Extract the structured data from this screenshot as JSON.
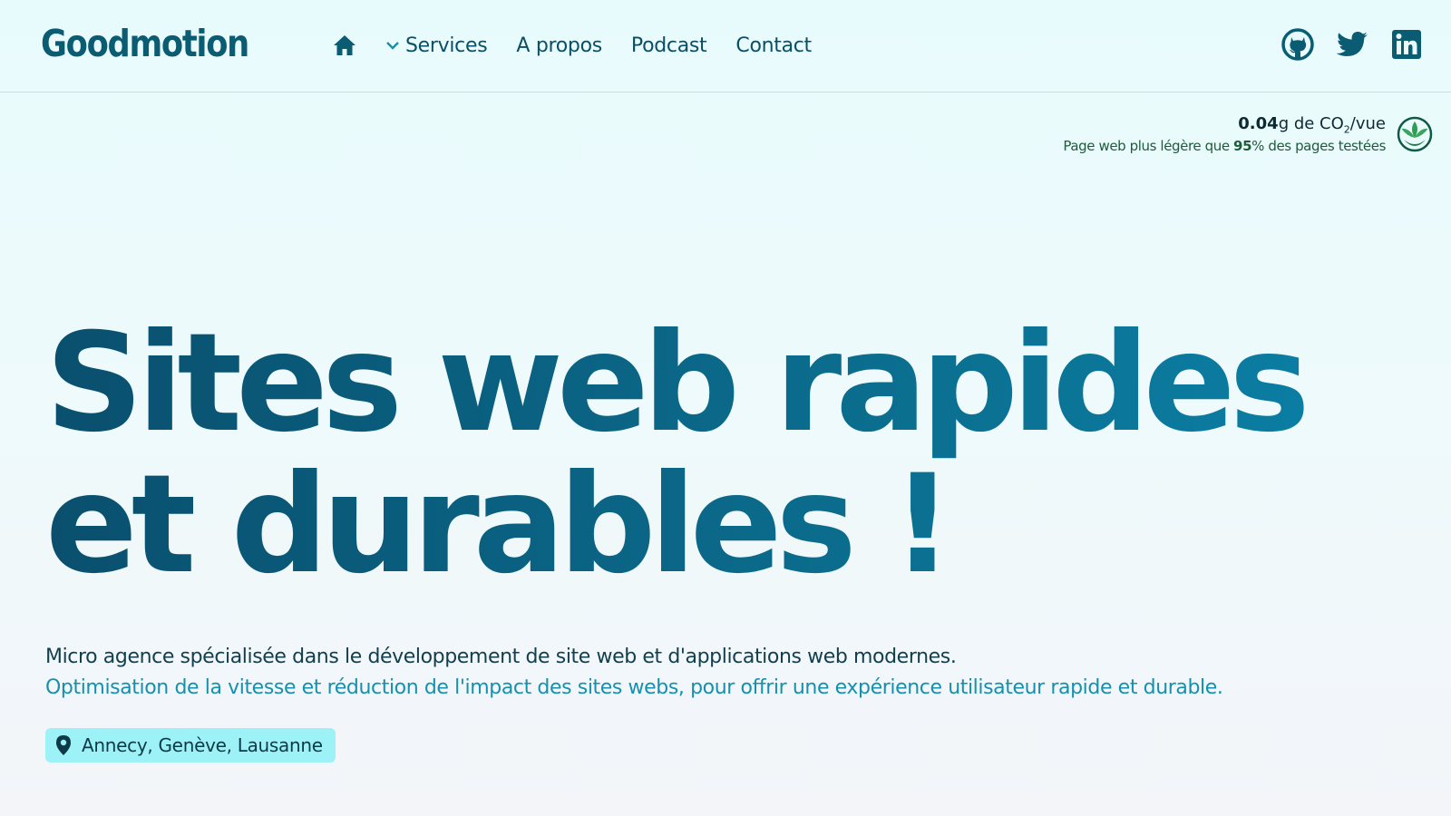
{
  "header": {
    "logo": "Goodmotion",
    "nav": {
      "home_icon": "home-icon",
      "items": [
        {
          "label": "Services",
          "has_dropdown": true
        },
        {
          "label": "A propos"
        },
        {
          "label": "Podcast"
        },
        {
          "label": "Contact"
        }
      ]
    },
    "socials": [
      "github-icon",
      "twitter-icon",
      "linkedin-icon"
    ]
  },
  "eco_badge": {
    "co2_value": "0.04",
    "co2_unit_prefix": "g de CO",
    "co2_sub": "2",
    "co2_suffix": "/vue",
    "line2_prefix": "Page web plus légère que ",
    "percent": "95",
    "line2_suffix": "% des pages testées",
    "icon": "leaf-icon"
  },
  "hero": {
    "title_line1": "Sites web rapides",
    "title_line2": "et durables !",
    "description_line1": "Micro agence spécialisée dans le développement de site web et d'applications web modernes.",
    "description_line2": "Optimisation de la vitesse et réduction de l'impact des sites webs, pour offrir une expérience utilisateur rapide et durable.",
    "location": "Annecy, Genève, Lausanne",
    "location_icon": "map-pin-icon"
  },
  "colors": {
    "brand": "#0a5c73",
    "accent": "#1590ad",
    "location_bg": "#9cf2f6",
    "eco_green": "#1e5b3b"
  }
}
